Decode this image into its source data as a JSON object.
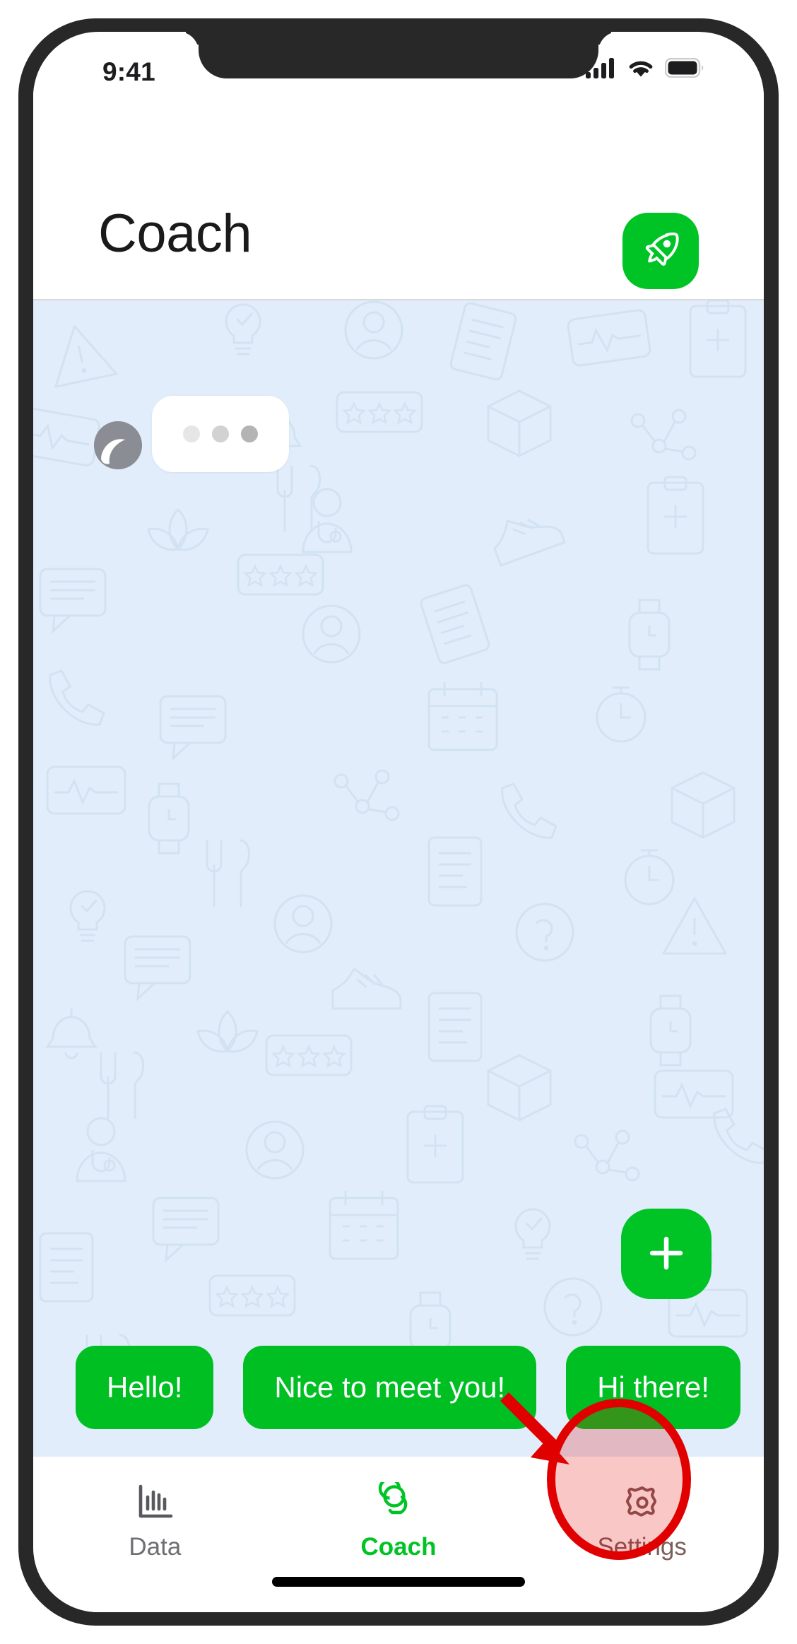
{
  "status_bar": {
    "time": "9:41",
    "cellular_icon": "cellular-signal-icon",
    "wifi_icon": "wifi-icon",
    "battery_icon": "battery-full-icon",
    "signal_bars": 4,
    "battery_level": 100
  },
  "header": {
    "title": "Coach",
    "action_icon": "rocket-icon",
    "action_color": "#00c425"
  },
  "chat": {
    "background_color": "#e1edfa",
    "avatar_icon": "coach-avatar-icon",
    "typing_indicator": {
      "visible": true,
      "dots": 3
    },
    "compose_button_icon": "plus-icon",
    "compose_button_color": "#00c425",
    "quick_replies": [
      {
        "label": "Hello!"
      },
      {
        "label": "Nice to meet you!"
      },
      {
        "label": "Hi there!"
      }
    ],
    "quick_reply_color": "#00bf22"
  },
  "tab_bar": {
    "active_color": "#00c425",
    "inactive_color": "#6e6e73",
    "items": [
      {
        "label": "Data",
        "icon": "bar-chart-icon",
        "active": false
      },
      {
        "label": "Coach",
        "icon": "chat-bubbles-icon",
        "active": true
      },
      {
        "label": "Settings",
        "icon": "gear-icon",
        "active": false
      }
    ]
  },
  "annotation": {
    "highlight_target": "Settings",
    "circle_color": "#e00000",
    "circle_fill": "rgba(230,0,0,0.22)",
    "arrow_color": "#e00000"
  }
}
